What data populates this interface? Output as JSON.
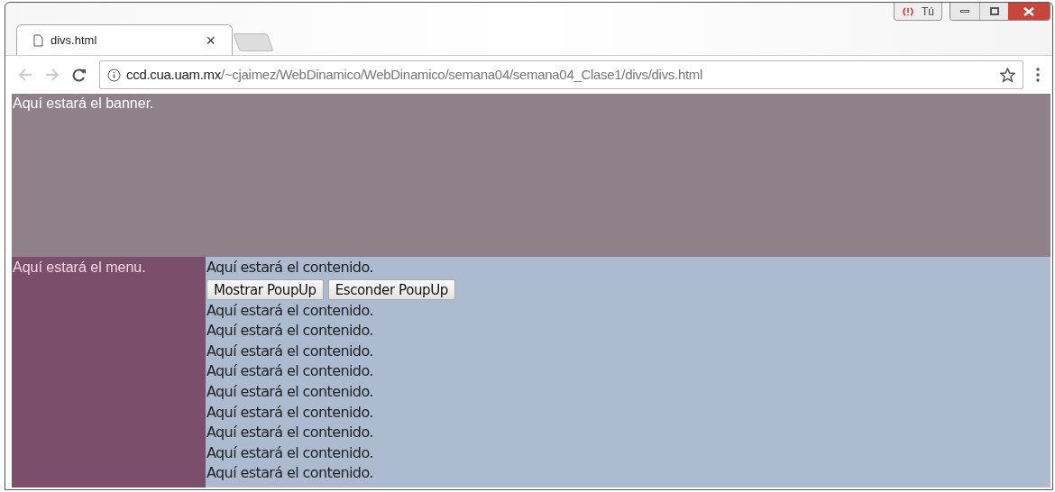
{
  "window": {
    "profile_label": "Tú"
  },
  "tabs": [
    {
      "title": "divs.html",
      "close": "×",
      "selected": true
    }
  ],
  "address_bar": {
    "host": "ccd.cua.uam.mx",
    "path": "/~cjaimez/WebDinamico/WebDinamico/semana04/semana04_Clase1/divs/divs.html"
  },
  "page": {
    "banner": "Aquí estará el banner.",
    "menu": "Aquí estará el menu.",
    "content_lines_before": [
      "Aquí estará el contenido."
    ],
    "buttons": [
      "Mostrar PoupUp",
      "Esconder PoupUp"
    ],
    "content_lines_after": [
      "Aquí estará el contenido.",
      "Aquí estará el contenido.",
      "Aquí estará el contenido.",
      "Aquí estará el contenido.",
      "Aquí estará el contenido.",
      "Aquí estará el contenido.",
      "Aquí estará el contenido.",
      "Aquí estará el contenido.",
      "Aquí estará el contenido."
    ]
  }
}
